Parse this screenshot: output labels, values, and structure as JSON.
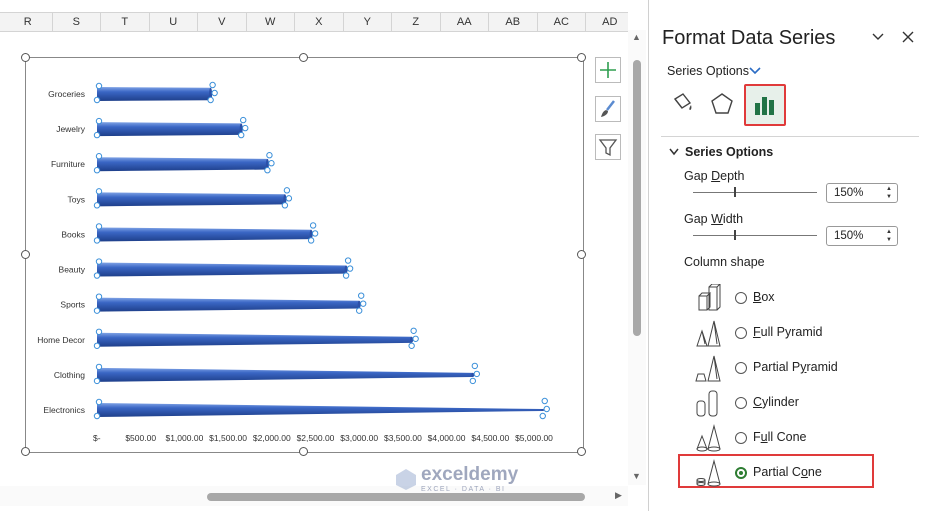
{
  "sheet": {
    "columns": [
      "R",
      "S",
      "T",
      "U",
      "V",
      "W",
      "X",
      "Y",
      "Z",
      "AA",
      "AB",
      "AC",
      "AD"
    ]
  },
  "chart_data": {
    "type": "bar",
    "orientation": "horizontal",
    "shape": "partial-cone",
    "categories": [
      "Groceries",
      "Jewelry",
      "Furniture",
      "Toys",
      "Books",
      "Beauty",
      "Sports",
      "Home Decor",
      "Clothing",
      "Electronics"
    ],
    "values": [
      1300,
      1650,
      1950,
      2150,
      2450,
      2850,
      3000,
      3600,
      4300,
      5100
    ],
    "xlim": [
      0,
      5000
    ],
    "ticks": [
      "$-",
      "$500.00",
      "$1,000.00",
      "$1,500.00",
      "$2,000.00",
      "$2,500.00",
      "$3,000.00",
      "$3,500.00",
      "$4,000.00",
      "$4,500.00",
      "$5,000.00"
    ],
    "tick_values": [
      0,
      500,
      1000,
      1500,
      2000,
      2500,
      3000,
      3500,
      4000,
      4500,
      5000
    ],
    "bar_color": "#3a66c4",
    "grid": false
  },
  "chart_buttons": {
    "add": "plus-icon",
    "style": "brush-icon",
    "filter": "funnel-icon"
  },
  "watermark": {
    "name": "exceldemy",
    "tagline": "EXCEL · DATA · BI"
  },
  "panel": {
    "title": "Format Data Series",
    "options_dropdown": "Series Options",
    "section_title": "Series Options",
    "gap_depth": {
      "label_pre": "Gap ",
      "label_key": "D",
      "label_post": "epth",
      "value": "150%",
      "level": 0.33
    },
    "gap_width": {
      "label_pre": "Gap ",
      "label_key": "W",
      "label_post": "idth",
      "value": "150%",
      "level": 0.33
    },
    "column_shape_label": "Column shape",
    "shapes": [
      {
        "key": "B",
        "rest": "ox",
        "selected": false
      },
      {
        "key": "F",
        "rest": "ull Pyramid",
        "selected": false
      },
      {
        "pre": "Partial P",
        "key": "y",
        "rest": "ramid",
        "selected": false
      },
      {
        "key": "C",
        "rest": "ylinder",
        "selected": false
      },
      {
        "pre": "F",
        "key": "u",
        "rest": "ll Cone",
        "selected": false
      },
      {
        "pre": "Partial C",
        "key": "o",
        "rest": "ne",
        "selected": true
      }
    ],
    "accent": "#217346",
    "highlight": "#e03a3a"
  }
}
